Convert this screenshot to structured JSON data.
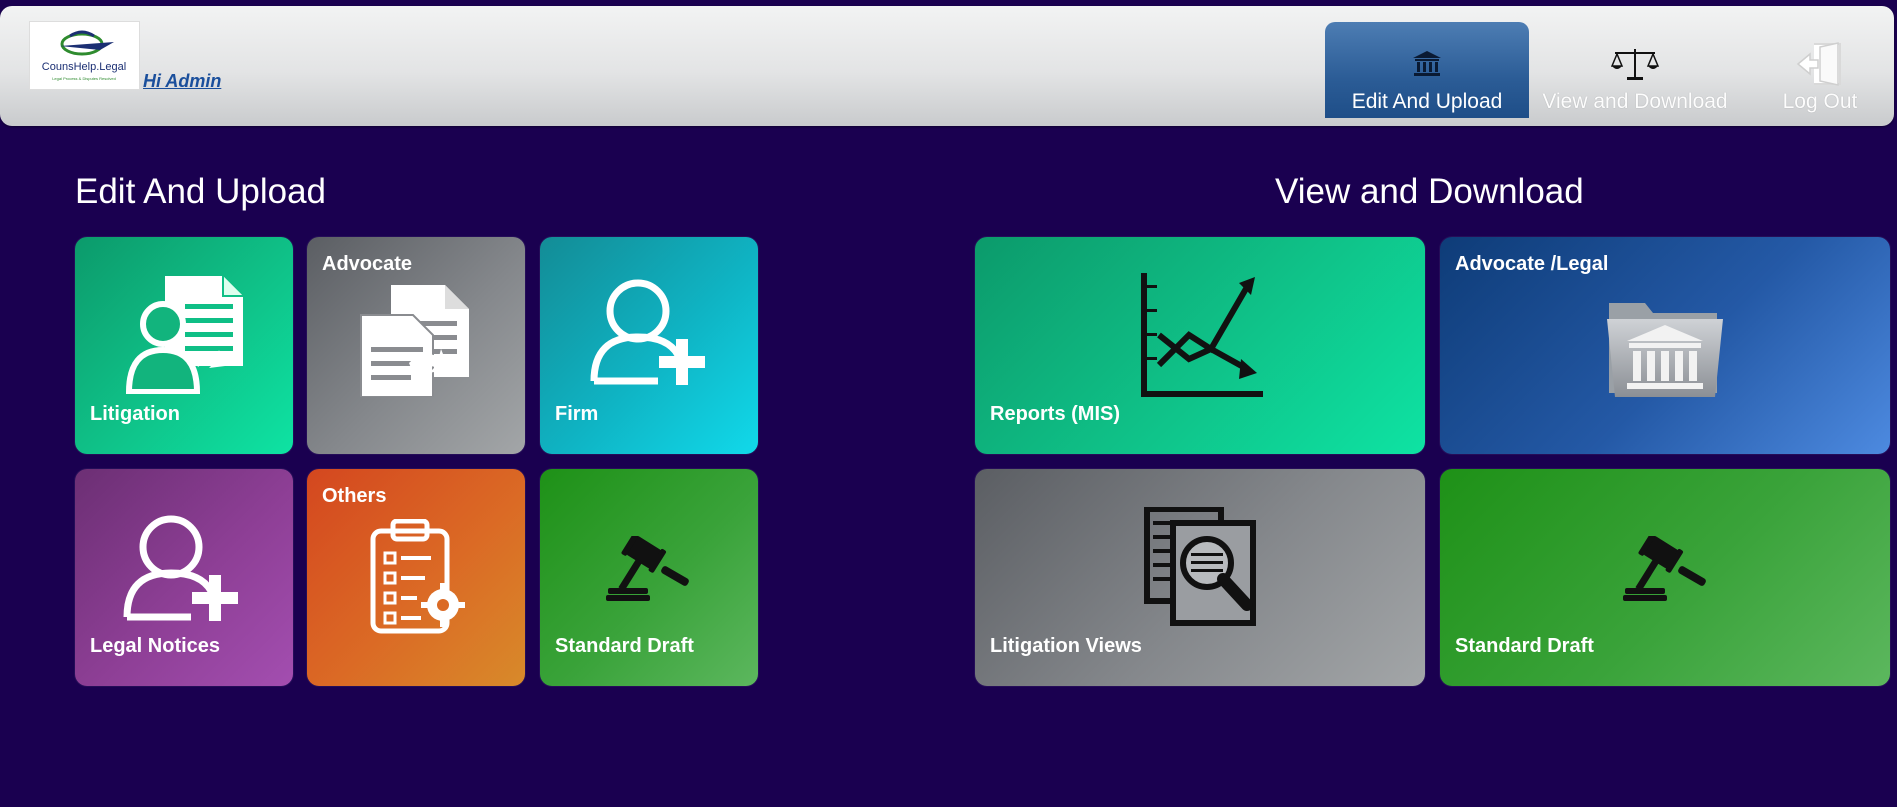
{
  "header": {
    "logo_text": "CounsHelp.Legal",
    "logo_tagline": "Legal Process & Disputes Resolved",
    "greeting": "Hi Admin",
    "nav": [
      {
        "label": "Edit And Upload",
        "icon": "bank-icon",
        "active": true
      },
      {
        "label": "View and Download",
        "icon": "scales-icon",
        "active": false
      },
      {
        "label": "Log Out",
        "icon": "logout-icon",
        "active": false
      }
    ]
  },
  "edit_section": {
    "title": "Edit And Upload",
    "tiles": [
      {
        "label": "Litigation",
        "icon": "user-document-icon",
        "color": "#0fbf86"
      },
      {
        "label": "Advocate",
        "icon": "documents-icon",
        "color": "#85888c"
      },
      {
        "label": "Firm",
        "icon": "add-user-icon",
        "color": "#0fb4c4"
      },
      {
        "label": "Legal Notices",
        "icon": "add-user-icon",
        "color": "#8e3f96"
      },
      {
        "label": "Others",
        "icon": "clipboard-settings-icon",
        "color": "#db6a25"
      },
      {
        "label": "Standard Draft",
        "icon": "gavel-icon",
        "color": "#3aa33a"
      }
    ]
  },
  "view_section": {
    "title": "View and Download",
    "tiles": [
      {
        "label": "Reports (MIS)",
        "icon": "line-chart-icon",
        "color": "#0fbf86"
      },
      {
        "label": "Advocate /Legal",
        "icon": "court-folder-icon",
        "color": "#2459a6"
      },
      {
        "label": "Litigation Views",
        "icon": "document-search-icon",
        "color": "#85888c"
      },
      {
        "label": "Standard Draft",
        "icon": "gavel-icon",
        "color": "#3aa33a"
      }
    ]
  }
}
